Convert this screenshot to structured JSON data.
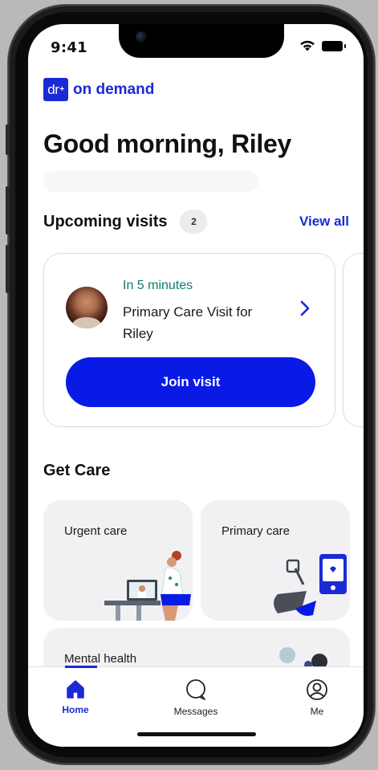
{
  "status_bar": {
    "time": "9:41"
  },
  "brand": {
    "badge": "dr",
    "badge_mark": "+",
    "name": "on demand",
    "color": "#1a2bd6"
  },
  "greeting": "Good morning, Riley",
  "upcoming": {
    "title": "Upcoming visits",
    "count": "2",
    "view_all": "View all",
    "visit": {
      "when": "In 5 minutes",
      "title": "Primary Care Visit for Riley",
      "join_label": "Join visit"
    }
  },
  "get_care": {
    "title": "Get Care",
    "tiles": [
      {
        "label": "Urgent care"
      },
      {
        "label": "Primary care"
      },
      {
        "label": "Mental health"
      }
    ]
  },
  "tabs": [
    {
      "label": "Home",
      "icon": "home-icon",
      "active": true
    },
    {
      "label": "Messages",
      "icon": "chat-bubble-icon",
      "active": false
    },
    {
      "label": "Me",
      "icon": "profile-icon",
      "active": false
    }
  ],
  "colors": {
    "accent": "#1a2bd6",
    "join_button": "#0a1ae6",
    "time_green": "#0e7d6c",
    "tile_bg": "#f1f1f3"
  }
}
